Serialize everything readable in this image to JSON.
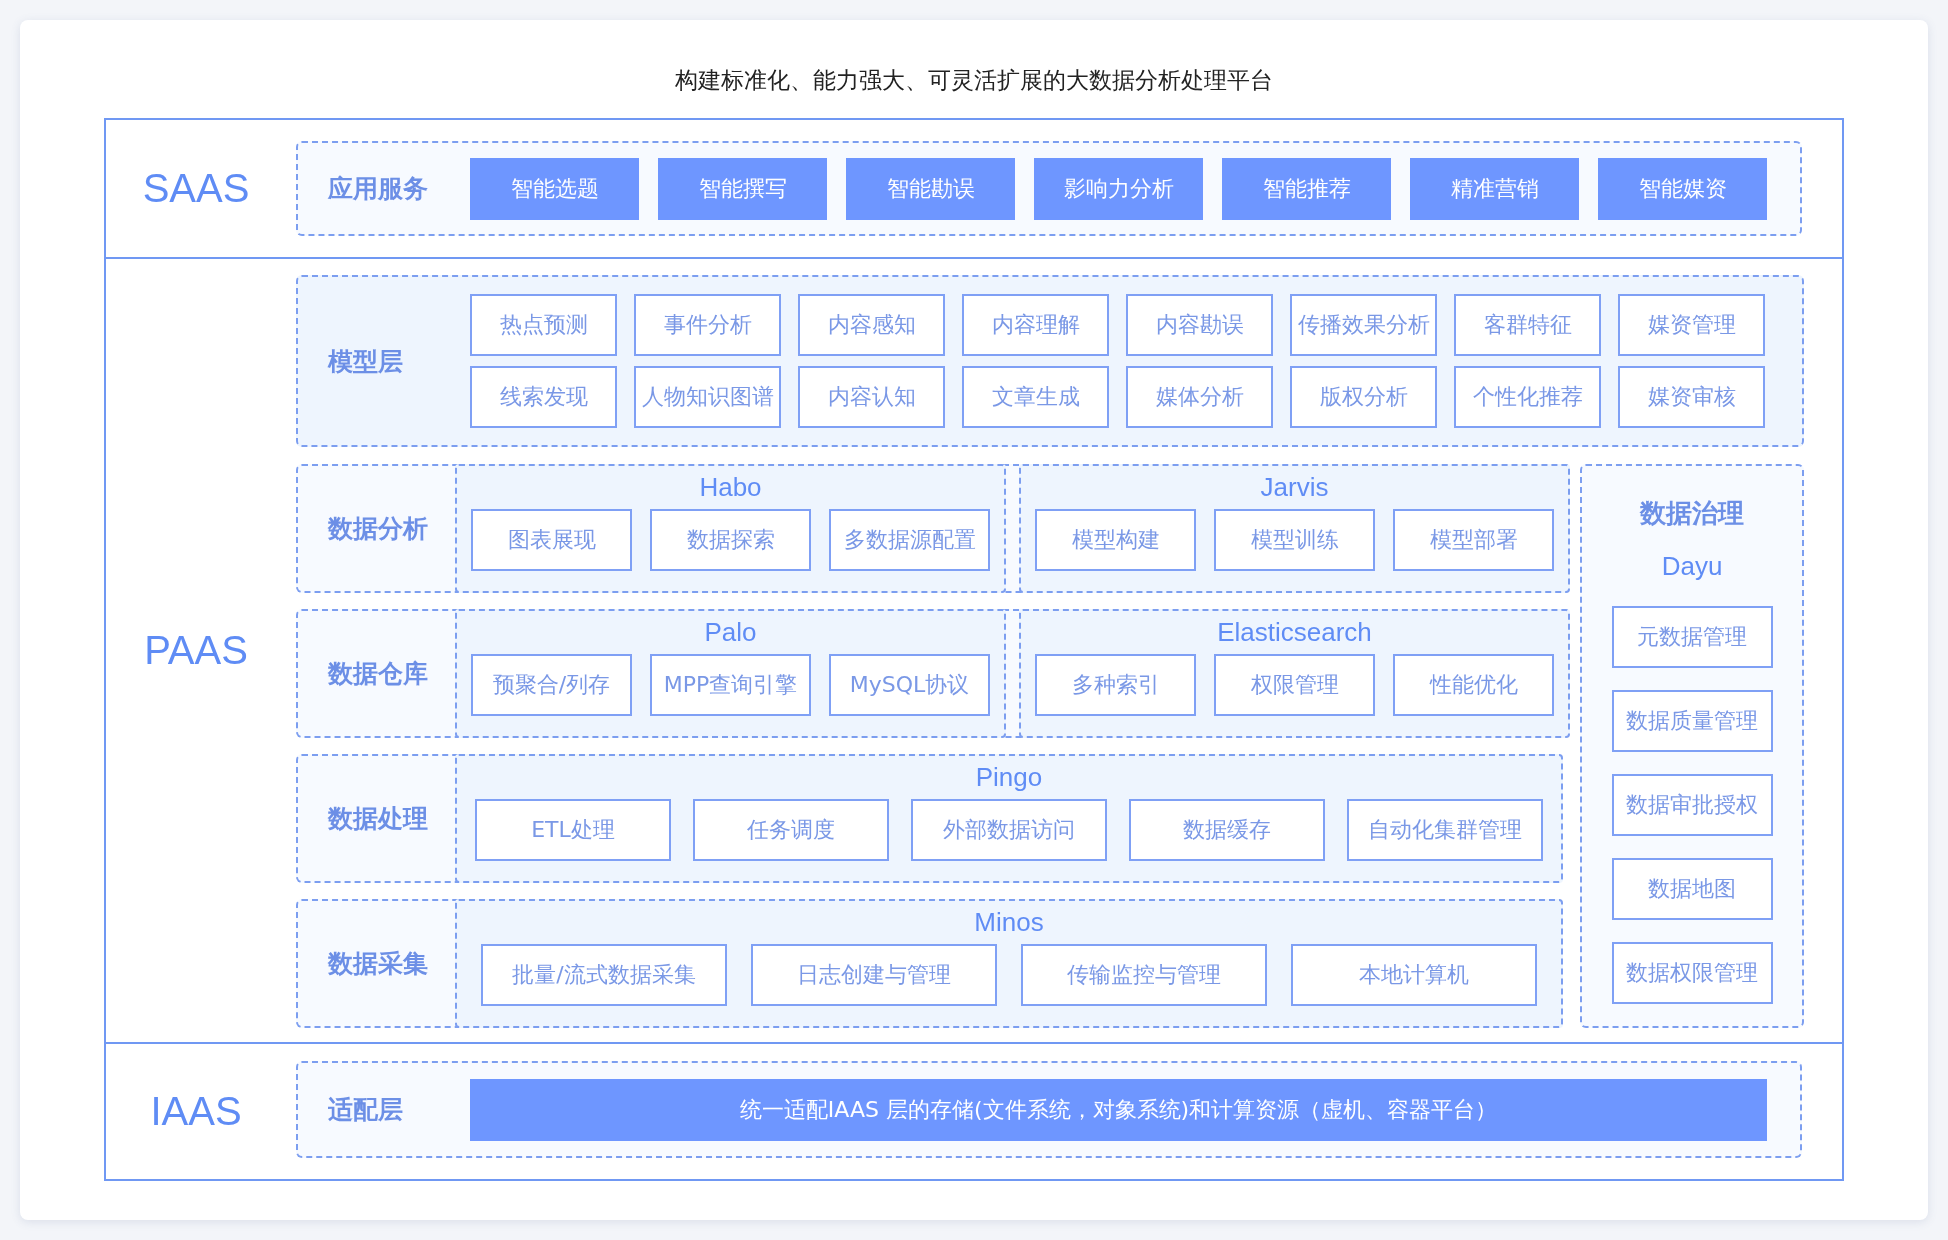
{
  "title": "构建标准化、能力强大、可灵活扩展的大数据分析处理平台",
  "layers": [
    {
      "name": "SAAS",
      "groups": [
        {
          "kind": "services",
          "label": "应用服务",
          "items": [
            "智能选题",
            "智能撰写",
            "智能勘误",
            "影响力分析",
            "智能推荐",
            "精准营销",
            "智能媒资"
          ]
        }
      ]
    },
    {
      "name": "PAAS",
      "groups": [
        {
          "kind": "grid",
          "label": "模型层",
          "items": [
            "热点预测",
            "事件分析",
            "内容感知",
            "内容理解",
            "内容勘误",
            "传播效果分析",
            "客群特征",
            "媒资管理",
            "线索发现",
            "人物知识图谱",
            "内容认知",
            "文章生成",
            "媒体分析",
            "版权分析",
            "个性化推荐",
            "媒资审核"
          ]
        },
        {
          "kind": "modules",
          "label": "数据分析",
          "modules": [
            {
              "name": "Habo",
              "items": [
                "图表展现",
                "数据探索",
                "多数据源配置"
              ]
            },
            {
              "name": "Jarvis",
              "items": [
                "模型构建",
                "模型训练",
                "模型部署"
              ]
            }
          ]
        },
        {
          "kind": "modules",
          "label": "数据仓库",
          "modules": [
            {
              "name": "Palo",
              "items": [
                "预聚合/列存",
                "MPP查询引擎",
                "MySQL协议"
              ]
            },
            {
              "name": "Elasticsearch",
              "items": [
                "多种索引",
                "权限管理",
                "性能优化"
              ]
            }
          ]
        },
        {
          "kind": "modules",
          "label": "数据处理",
          "modules": [
            {
              "name": "Pingo",
              "items": [
                "ETL处理",
                "任务调度",
                "外部数据访问",
                "数据缓存",
                "自动化集群管理"
              ]
            }
          ]
        },
        {
          "kind": "modules",
          "label": "数据采集",
          "modules": [
            {
              "name": "Minos",
              "items": [
                "批量/流式数据采集",
                "日志创建与管理",
                "传输监控与管理",
                "本地计算机"
              ]
            }
          ]
        }
      ],
      "side": {
        "title": "数据治理",
        "subtitle": "Dayu",
        "items": [
          "元数据管理",
          "数据质量管理",
          "数据审批授权",
          "数据地图",
          "数据权限管理"
        ]
      }
    },
    {
      "name": "IAAS",
      "groups": [
        {
          "kind": "bar",
          "label": "适配层",
          "text": "统一适配IAAS 层的存储(文件系统，对象系统)和计算资源（虚机、容器平台）"
        }
      ]
    }
  ]
}
